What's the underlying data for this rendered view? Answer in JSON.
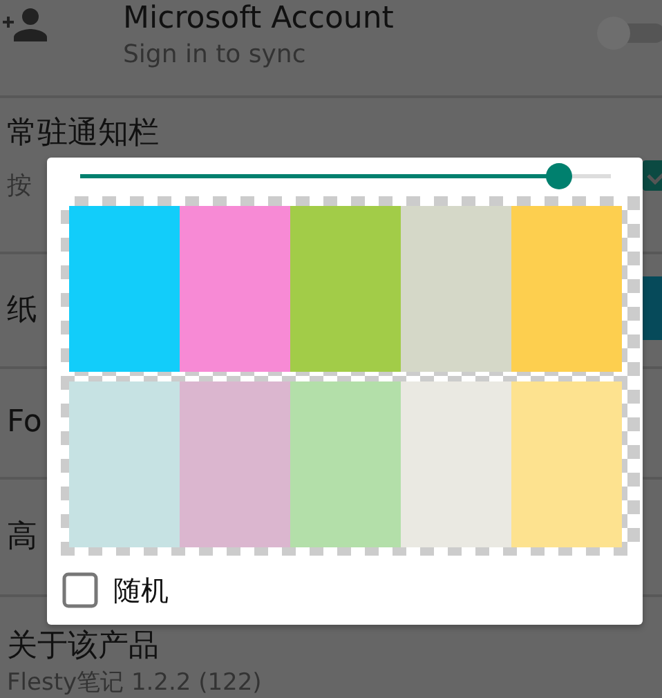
{
  "settings": [
    {
      "kind": "account",
      "title": "Microsoft Account",
      "subtitle": "Sign in to sync",
      "on": false
    },
    {
      "kind": "checkbox",
      "title": "常驻通知栏",
      "subtitle": "按",
      "checked": true
    },
    {
      "kind": "swatch",
      "title": "纸",
      "color": "#064a5a"
    },
    {
      "kind": "plain",
      "title": "Fo"
    },
    {
      "kind": "plain",
      "title": "高"
    },
    {
      "kind": "about",
      "title": "关于该产品",
      "subtitle": "Flesty笔记 1.2.2 (122)"
    }
  ],
  "dialog": {
    "slider": {
      "level": 0.9
    },
    "swatches": [
      {
        "color": "#12cdfa"
      },
      {
        "color": "#f78ad5"
      },
      {
        "color": "#a2cc48"
      },
      {
        "color": "#d5d8c8"
      },
      {
        "color": "#fdcf4f"
      },
      {
        "color": "#c6e2e3"
      },
      {
        "color": "#dbb6cf"
      },
      {
        "color": "#b3dfa9"
      },
      {
        "color": "#eae9e2"
      },
      {
        "color": "#fde28f"
      }
    ],
    "random": {
      "label": "随机",
      "checked": false
    }
  }
}
